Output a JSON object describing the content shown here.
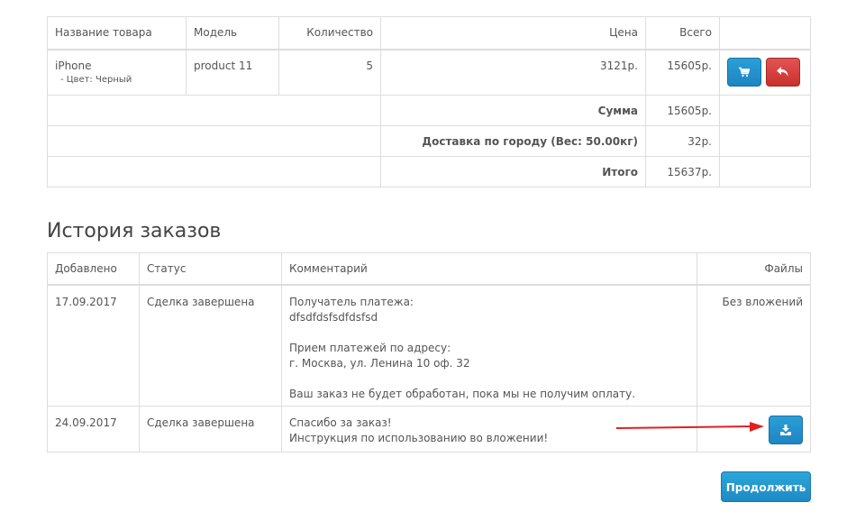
{
  "products": {
    "headers": {
      "name": "Название товара",
      "model": "Модель",
      "qty": "Количество",
      "price": "Цена",
      "total": "Всего"
    },
    "items": [
      {
        "name": "iPhone",
        "option": "- Цвет: Черный",
        "model": "product 11",
        "qty": "5",
        "price": "3121р.",
        "total": "15605р."
      }
    ],
    "totals": [
      {
        "label": "Сумма",
        "value": "15605р."
      },
      {
        "label": "Доставка по городу (Вес: 50.00кг)",
        "value": "32р."
      },
      {
        "label": "Итого",
        "value": "15637р."
      }
    ]
  },
  "history": {
    "title": "История заказов",
    "headers": {
      "date": "Добавлено",
      "status": "Статус",
      "comment": "Комментарий",
      "files": "Файлы"
    },
    "rows": [
      {
        "date": "17.09.2017",
        "status": "Сделка завершена",
        "comment_lines": [
          "Получатель платежа:",
          "dfsdfdsfsdfdsfsd",
          "",
          "Прием платежей по адресу:",
          "г. Москва, ул. Ленина 10 оф. 32",
          "",
          "Ваш заказ не будет обработан, пока мы не получим оплату."
        ],
        "files": "Без вложений"
      },
      {
        "date": "24.09.2017",
        "status": "Сделка завершена",
        "comment_lines": [
          "Спасибо за заказ!",
          "Инструкция по использованию во вложении!"
        ],
        "files": ""
      }
    ]
  },
  "buttons": {
    "continue": "Продолжить",
    "cart_icon": "shopping-cart-icon",
    "return_icon": "reply-arrow-icon",
    "download_icon": "download-icon"
  },
  "colors": {
    "primary": "#1e85c3",
    "danger": "#c9302c",
    "annotation_arrow": "#e02020"
  }
}
